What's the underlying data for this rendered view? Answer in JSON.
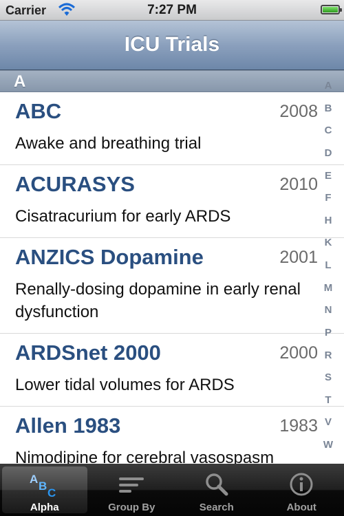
{
  "status_bar": {
    "carrier": "Carrier",
    "time": "7:27 PM",
    "battery_level": 1.0
  },
  "nav": {
    "title": "ICU Trials"
  },
  "section": {
    "letter": "A"
  },
  "trials": [
    {
      "name": "ABC",
      "year": "2008",
      "description": "Awake and breathing trial"
    },
    {
      "name": "ACURASYS",
      "year": "2010",
      "description": "Cisatracurium for early ARDS"
    },
    {
      "name": "ANZICS Dopamine",
      "year": "2001",
      "description": "Renally-dosing dopamine in early renal dysfunction"
    },
    {
      "name": "ARDSnet 2000",
      "year": "2000",
      "description": "Lower tidal volumes for ARDS"
    },
    {
      "name": "Allen 1983",
      "year": "1983",
      "description": "Nimodipine for cerebral vasospasm"
    }
  ],
  "index_letters": [
    "A",
    "B",
    "C",
    "D",
    "E",
    "F",
    "H",
    "K",
    "L",
    "M",
    "N",
    "P",
    "R",
    "S",
    "T",
    "V",
    "W"
  ],
  "tabs": [
    {
      "label": "Alpha",
      "icon": "abc-icon",
      "selected": true
    },
    {
      "label": "Group By",
      "icon": "list-lines-icon",
      "selected": false
    },
    {
      "label": "Search",
      "icon": "magnifier-icon",
      "selected": false
    },
    {
      "label": "About",
      "icon": "info-icon",
      "selected": false
    }
  ],
  "colors": {
    "accent": "#2a4f80",
    "nav": "#8ba0bd",
    "tabbar": "#1f1f1f"
  }
}
